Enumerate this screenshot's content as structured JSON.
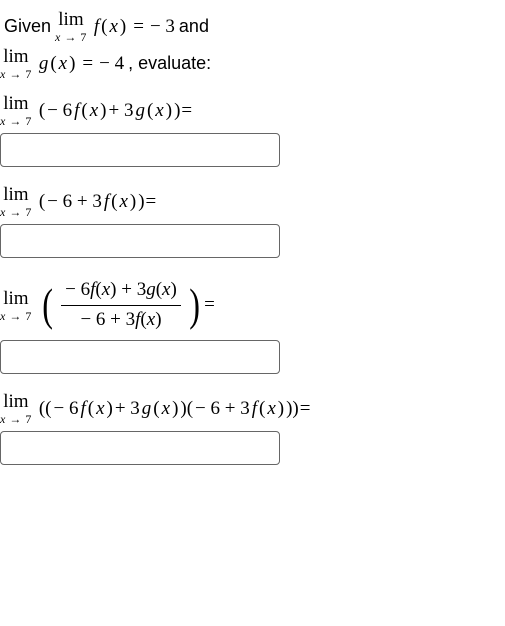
{
  "given": {
    "prefix": "Given",
    "lim_label": "lim",
    "lim_sub": "x → 7",
    "fx": "f(x)",
    "gx": "g(x)",
    "eq": " = ",
    "fval": " − 3",
    "gval": " − 4",
    "and": " and",
    "evaluate": ", evaluate:"
  },
  "q1": {
    "lim_label": "lim",
    "lim_sub": "x → 7",
    "expr": "( − 6f(x) + 3g(x))",
    "eq": " ="
  },
  "q2": {
    "lim_label": "lim",
    "lim_sub": "x → 7",
    "expr": "( − 6 + 3f(x))",
    "eq": " ="
  },
  "q3": {
    "lim_label": "lim",
    "lim_sub": "x → 7",
    "num": "− 6f(x) + 3g(x)",
    "den": "− 6 + 3f(x)",
    "eq": " ="
  },
  "q4": {
    "lim_label": "lim",
    "lim_sub": "x → 7",
    "expr": "(( − 6f(x) + 3g(x))( − 6 + 3f(x)))",
    "eq": " ="
  },
  "inputs": {
    "a1": "",
    "a2": "",
    "a3": "",
    "a4": ""
  }
}
